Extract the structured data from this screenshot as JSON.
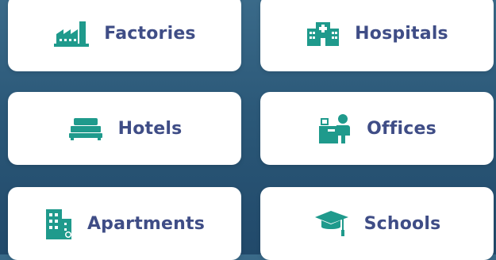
{
  "categories": [
    {
      "label": "Factories",
      "icon": "factory-icon"
    },
    {
      "label": "Hospitals",
      "icon": "hospital-icon"
    },
    {
      "label": "Hotels",
      "icon": "bed-icon"
    },
    {
      "label": "Offices",
      "icon": "office-worker-icon"
    },
    {
      "label": "Apartments",
      "icon": "apartment-building-icon"
    },
    {
      "label": "Schools",
      "icon": "graduation-cap-icon"
    }
  ],
  "colors": {
    "background_top": "#3a6a89",
    "background_bottom": "#21496a",
    "card": "#ffffff",
    "icon": "#1f9a8c",
    "label": "#3f4d86"
  }
}
